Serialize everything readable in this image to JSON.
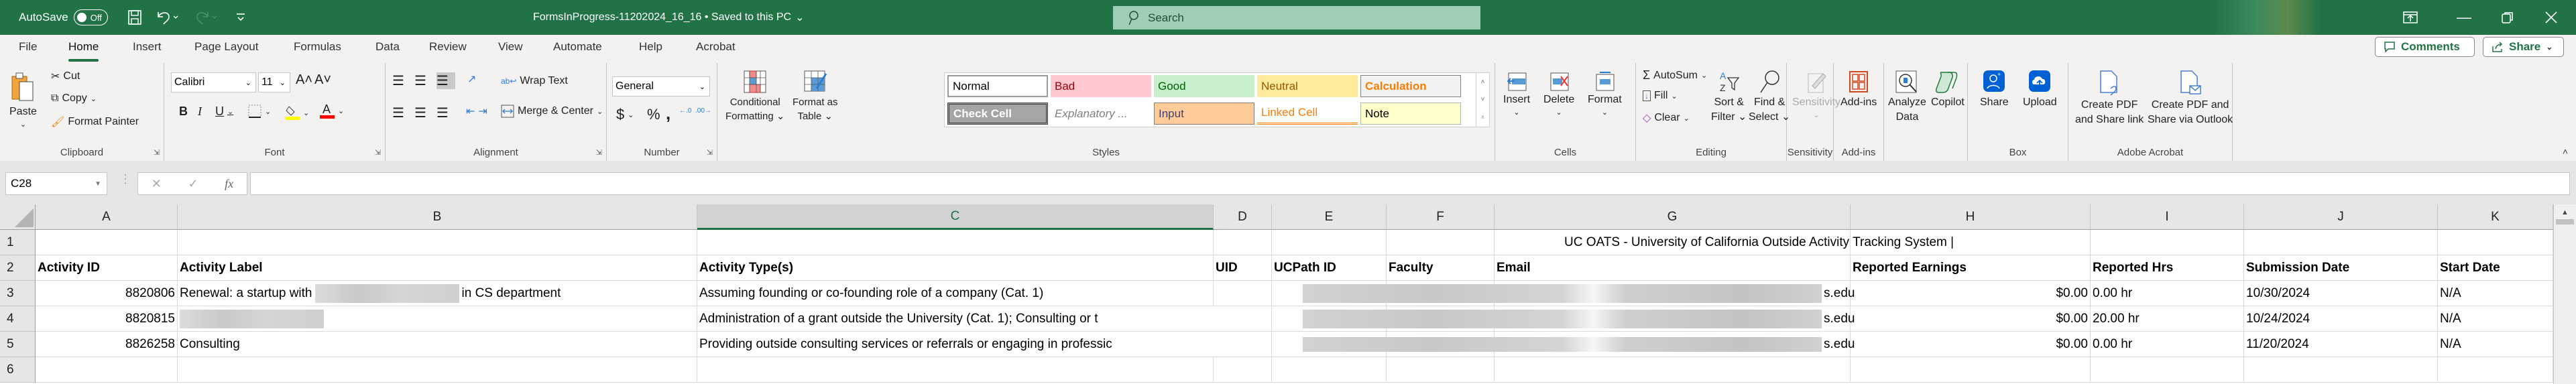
{
  "titlebar": {
    "autosave_label": "AutoSave",
    "autosave_state": "Off",
    "document_title": "FormsInProgress-11202024_16_16 • Saved to this PC",
    "search_placeholder": "Search"
  },
  "ribbon_tabs": [
    "File",
    "Home",
    "Insert",
    "Page Layout",
    "Formulas",
    "Data",
    "Review",
    "View",
    "Automate",
    "Help",
    "Acrobat"
  ],
  "active_tab": "Home",
  "top_buttons": {
    "comments": "Comments",
    "share": "Share"
  },
  "ribbon": {
    "clipboard": {
      "label": "Clipboard",
      "paste": "Paste",
      "cut": "Cut",
      "copy": "Copy",
      "format_painter": "Format Painter"
    },
    "font": {
      "label": "Font",
      "font_name": "Calibri",
      "font_size": "11",
      "bold": "B",
      "italic": "I",
      "underline": "U",
      "fill_color": "#ffff00",
      "font_color": "#ff0000"
    },
    "alignment": {
      "label": "Alignment",
      "wrap_text": "Wrap Text",
      "merge_center": "Merge & Center"
    },
    "number": {
      "label": "Number",
      "format": "General",
      "currency": "$",
      "percent": "%",
      "comma": ","
    },
    "styles": {
      "label": "Styles",
      "conditional_formatting": [
        "Conditional",
        "Formatting"
      ],
      "format_as_table": [
        "Format as",
        "Table"
      ],
      "gallery": [
        {
          "name": "Normal",
          "bg": "#ffffff",
          "fg": "#000000"
        },
        {
          "name": "Bad",
          "bg": "#ffc7ce",
          "fg": "#9c0006"
        },
        {
          "name": "Good",
          "bg": "#c6efce",
          "fg": "#006100"
        },
        {
          "name": "Neutral",
          "bg": "#ffeb9c",
          "fg": "#9c5700"
        },
        {
          "name": "Calculation",
          "bg": "#f2f2f2",
          "fg": "#fa7d00"
        },
        {
          "name": "Check Cell",
          "bg": "#a5a5a5",
          "fg": "#ffffff"
        },
        {
          "name": "Explanatory ...",
          "bg": "#ffffff",
          "fg": "#7f7f7f"
        },
        {
          "name": "Input",
          "bg": "#ffcc99",
          "fg": "#3f3f76"
        },
        {
          "name": "Linked Cell",
          "bg": "#ffffff",
          "fg": "#fa7d00"
        },
        {
          "name": "Note",
          "bg": "#ffffcc",
          "fg": "#000000"
        }
      ]
    },
    "cells": {
      "label": "Cells",
      "insert": "Insert",
      "delete": "Delete",
      "format": "Format"
    },
    "editing": {
      "label": "Editing",
      "autosum": "AutoSum",
      "fill": "Fill",
      "clear": "Clear",
      "sort_filter": [
        "Sort &",
        "Filter"
      ],
      "find_select": [
        "Find &",
        "Select"
      ]
    },
    "sensitivity": {
      "label": "Sensitivity",
      "button": "Sensitivity"
    },
    "addins": {
      "label": "Add-ins",
      "button": "Add-ins"
    },
    "analysis": {
      "analyze_data": [
        "Analyze",
        "Data"
      ],
      "copilot": "Copilot"
    },
    "box": {
      "label": "Box",
      "share": "Share",
      "upload": "Upload"
    },
    "acrobat": {
      "label": "Adobe Acrobat",
      "create_share_link": [
        "Create PDF",
        "and Share link"
      ],
      "create_share_outlook": [
        "Create PDF and",
        "Share via Outlook"
      ]
    }
  },
  "formula_bar": {
    "name_box": "C28",
    "formula": ""
  },
  "sheet": {
    "columns": [
      "A",
      "B",
      "C",
      "D",
      "E",
      "F",
      "G",
      "H",
      "I",
      "J",
      "K"
    ],
    "selected_column": "C",
    "row_numbers": [
      "1",
      "2",
      "3",
      "4",
      "5",
      "6"
    ],
    "title_row": "UC OATS - University of California Outside Activity Tracking System |",
    "headers": [
      "Activity ID",
      "Activity Label",
      "Activity Type(s)",
      "UID",
      "UCPath ID",
      "Faculty",
      "Email",
      "Reported Earnings",
      "Reported Hrs",
      "Submission Date",
      "Start Date"
    ],
    "rows": [
      {
        "activity_id": "8820806",
        "label_prefix": "Renewal: a startup with",
        "label_suffix": "in CS department",
        "activity_type": "Assuming founding or co-founding role of a company (Cat. 1)",
        "uid": "",
        "email_suffix": "s.edu",
        "earnings": "$0.00",
        "hours": "0.00 hr",
        "submission_date": "10/30/2024",
        "start_date": "N/A"
      },
      {
        "activity_id": "8820815",
        "label_prefix": "",
        "label_suffix": "",
        "activity_type": "Administration of a grant outside the University (Cat. 1);  Consulting or t",
        "uid": "",
        "email_suffix": "s.edu",
        "earnings": "$0.00",
        "hours": "20.00 hr",
        "submission_date": "10/24/2024",
        "start_date": "N/A"
      },
      {
        "activity_id": "8826258",
        "label_prefix": "Consulting",
        "label_suffix": "",
        "activity_type": "Providing outside consulting services or referrals or engaging in professic",
        "uid": "",
        "email_suffix": "s.edu",
        "earnings": "$0.00",
        "hours": "0.00 hr",
        "submission_date": "11/20/2024",
        "start_date": "N/A"
      }
    ]
  }
}
